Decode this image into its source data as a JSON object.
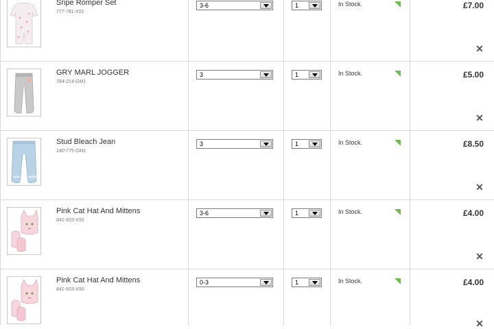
{
  "basket": {
    "items": [
      {
        "name": "Sripe Romper Set",
        "code": "777-781-X51",
        "size": "3-6",
        "qty": "1",
        "stock": "In Stock.",
        "price": "£7.00"
      },
      {
        "name": "GRY MARL JOGGER",
        "code": "784-214-GM1",
        "size": "3",
        "qty": "1",
        "stock": "In Stock.",
        "price": "£5.00"
      },
      {
        "name": "Stud Bleach Jean",
        "code": "140-775-GM1",
        "size": "3",
        "qty": "1",
        "stock": "In Stock.",
        "price": "£8.50"
      },
      {
        "name": "Pink Cat Hat And Mittens",
        "code": "841-933-X50",
        "size": "3-6",
        "qty": "1",
        "stock": "In Stock.",
        "price": "£4.00"
      },
      {
        "name": "Pink Cat Hat And Mittens",
        "code": "841-933-X50",
        "size": "0-3",
        "qty": "1",
        "stock": "In Stock.",
        "price": "£4.00"
      }
    ]
  },
  "remove_symbol": "✕",
  "colors": {
    "stock_flag": "#6cc04a",
    "grid": "#d9d9d9"
  }
}
